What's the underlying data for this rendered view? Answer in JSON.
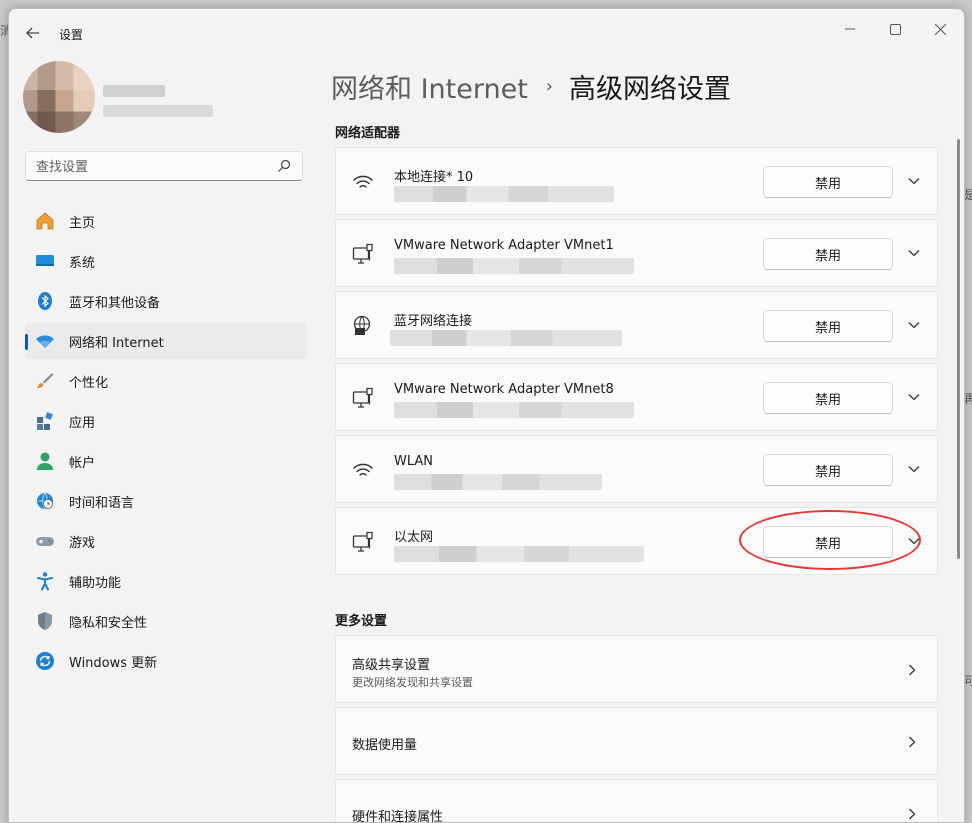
{
  "window": {
    "app_title": "设置",
    "controls": {
      "minimize": "—",
      "maximize": "☐",
      "close": "✕"
    }
  },
  "search": {
    "placeholder": "查找设置"
  },
  "nav": [
    {
      "id": "home",
      "label": "主页",
      "icon": "home-icon"
    },
    {
      "id": "system",
      "label": "系统",
      "icon": "system-icon"
    },
    {
      "id": "bluetooth",
      "label": "蓝牙和其他设备",
      "icon": "bluetooth-icon"
    },
    {
      "id": "network",
      "label": "网络和 Internet",
      "icon": "wifi-icon",
      "active": true
    },
    {
      "id": "personalization",
      "label": "个性化",
      "icon": "brush-icon"
    },
    {
      "id": "apps",
      "label": "应用",
      "icon": "apps-icon"
    },
    {
      "id": "accounts",
      "label": "帐户",
      "icon": "account-icon"
    },
    {
      "id": "time-language",
      "label": "时间和语言",
      "icon": "globe-clock-icon"
    },
    {
      "id": "gaming",
      "label": "游戏",
      "icon": "gamepad-icon"
    },
    {
      "id": "accessibility",
      "label": "辅助功能",
      "icon": "accessibility-icon"
    },
    {
      "id": "privacy",
      "label": "隐私和安全性",
      "icon": "shield-icon"
    },
    {
      "id": "windows-update",
      "label": "Windows 更新",
      "icon": "update-icon"
    }
  ],
  "breadcrumb": {
    "parent": "网络和 Internet",
    "separator": "›",
    "current": "高级网络设置"
  },
  "adapters_section": {
    "title": "网络适配器",
    "adapters": [
      {
        "name": "本地连接* 10",
        "icon": "wifi-icon",
        "button": "禁用"
      },
      {
        "name": "VMware Network Adapter VMnet1",
        "icon": "ethernet-monitor-icon",
        "button": "禁用"
      },
      {
        "name": "蓝牙网络连接",
        "icon": "globe-monitor-icon",
        "button": "禁用"
      },
      {
        "name": "VMware Network Adapter VMnet8",
        "icon": "ethernet-monitor-icon",
        "button": "禁用"
      },
      {
        "name": "WLAN",
        "icon": "wifi-icon",
        "button": "禁用"
      },
      {
        "name": "以太网",
        "icon": "ethernet-monitor-icon",
        "button": "禁用",
        "highlighted": true
      }
    ]
  },
  "more_section": {
    "title": "更多设置",
    "items": [
      {
        "title": "高级共享设置",
        "desc": "更改网络发现和共享设置"
      },
      {
        "title": "数据使用量",
        "desc": ""
      },
      {
        "title": "硬件和连接属性",
        "desc": ""
      }
    ]
  },
  "colors": {
    "accent": "#005fb8",
    "highlight_circle": "#e53935",
    "background": "#f3f3f3"
  }
}
